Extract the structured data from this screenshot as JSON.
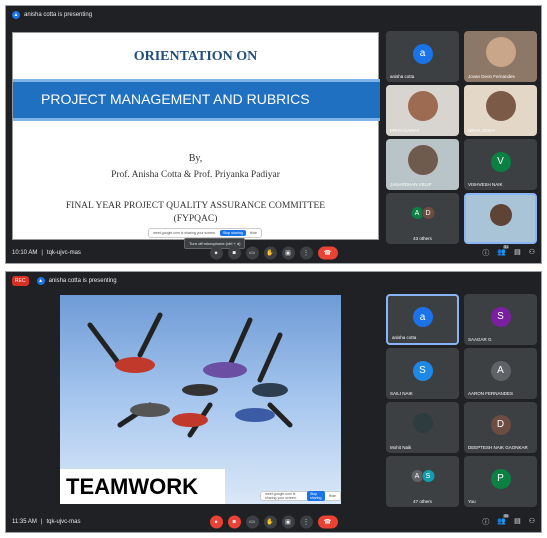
{
  "m1": {
    "presenting": "anisha cotta is presenting",
    "slide": {
      "title": "ORIENTATION ON",
      "band": "PROJECT MANAGEMENT AND RUBRICS",
      "by": "By,",
      "profs": "Prof. Anisha Cotta & Prof. Priyanka Padiyar",
      "committee": "FINAL YEAR PROJECT QUALITY ASSURANCE COMMITTEE",
      "abbr": "(FYPQAC)"
    },
    "share": {
      "text": "meet.google.com is sharing your screen.",
      "stop": "Stop sharing",
      "hide": "Hide"
    },
    "tooltip": "Turn off microphone (ctrl + d)",
    "tiles": [
      {
        "name": "anisha cotta",
        "avatar": "a",
        "color": "#1a73e8"
      },
      {
        "name": "Jovan Deon Fernandes"
      },
      {
        "name": "PRIYA KAMAT"
      },
      {
        "name": "NEHA JOSHI"
      },
      {
        "name": "JANARDHAN VELIP"
      },
      {
        "name": "VISHVESH NAIK",
        "avatar": "V",
        "color": "#0b8043"
      },
      {
        "name": "43 others",
        "a1": "A",
        "a2": "D"
      },
      {
        "name": ""
      }
    ],
    "time": "10:10 AM",
    "code": "tqk-ujvc-mas",
    "people_count": "51"
  },
  "m2": {
    "rec": "REC",
    "presenting": "anisha cotta is presenting",
    "slide_text": "TEAMWORK",
    "share": {
      "text": "meet.google.com is sharing your screen.",
      "stop": "Stop sharing",
      "hide": "Hide"
    },
    "tiles": [
      {
        "name": "anisha cotta",
        "avatar": "a",
        "color": "#1a73e8"
      },
      {
        "name": "SAAGAR G",
        "avatar": "S",
        "color": "#7b1fa2"
      },
      {
        "name": "SAILI NAIK",
        "avatar": "S",
        "color": "#1e88e5"
      },
      {
        "name": "AARON FERNANDES",
        "avatar": "A",
        "color": "#5f6368"
      },
      {
        "name": "Mohit Naik"
      },
      {
        "name": "DEEPTESH NAIK GAONKAR",
        "avatar": "D",
        "color": "#6d4c41"
      },
      {
        "name": "47 others",
        "a1": "A",
        "a2": "S"
      },
      {
        "name": "You",
        "avatar": "P",
        "color": "#0b8043"
      }
    ],
    "time": "11:35 AM",
    "code": "tqk-ujvc-mas",
    "people_count": "55"
  }
}
